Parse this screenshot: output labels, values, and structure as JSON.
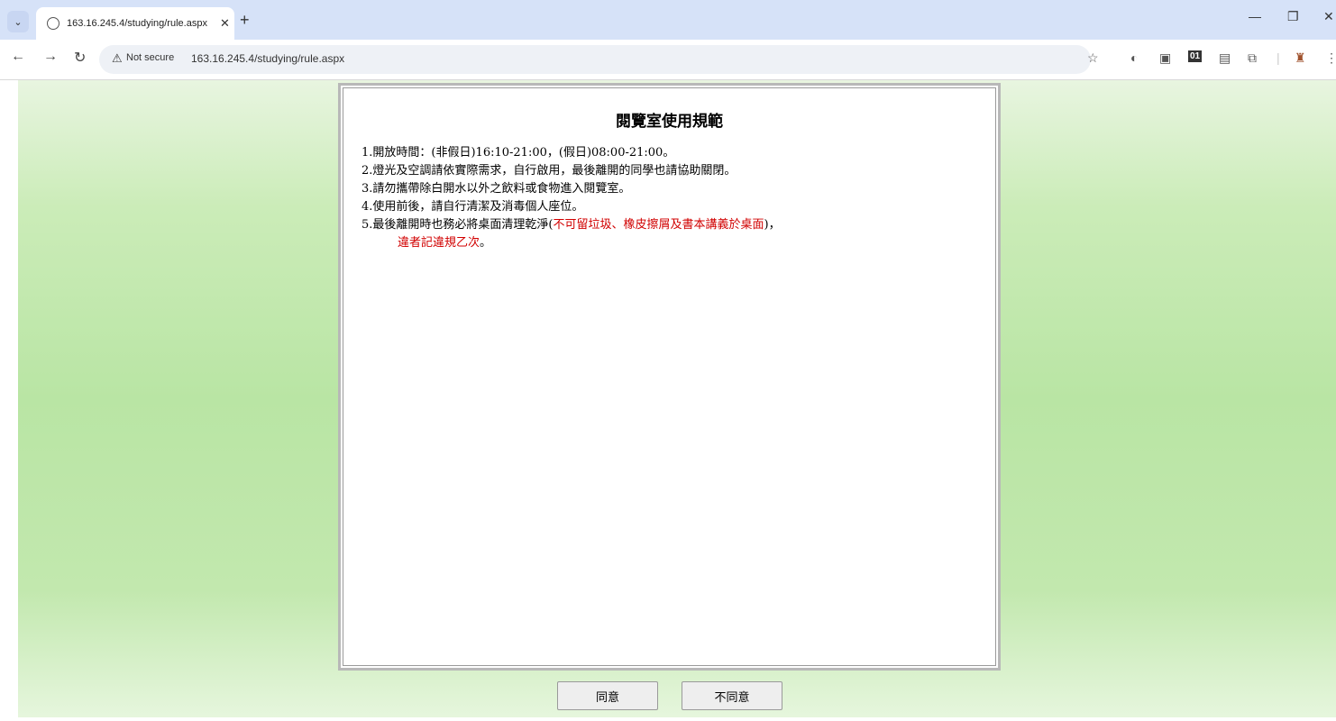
{
  "browser": {
    "tab_title": "163.16.245.4/studying/rule.aspx",
    "security_label": "Not secure",
    "url": "163.16.245.4/studying/rule.aspx"
  },
  "page": {
    "title": "閱覽室使用規範",
    "rules": [
      "1.開放時間：(非假日)16:10-21:00，(假日)08:00-21:00。",
      "2.燈光及空調請依實際需求，自行啟用，最後離開的同學也請協助關閉。",
      "3.請勿攜帶除白開水以外之飲料或食物進入閱覽室。",
      "4.使用前後，請自行清潔及消毒個人座位。"
    ],
    "rule5_prefix": "5.最後離開時也務必將桌面清理乾淨(",
    "rule5_red": "不可留垃圾、橡皮擦屑及書本講義於桌面",
    "rule5_suffix": ")，",
    "rule5_penalty": "違者記違規乙次",
    "rule5_end": "。",
    "agree_label": "同意",
    "disagree_label": "不同意"
  },
  "colors": {
    "warning_text": "#d10000",
    "background_green": "#b9e5a4"
  }
}
